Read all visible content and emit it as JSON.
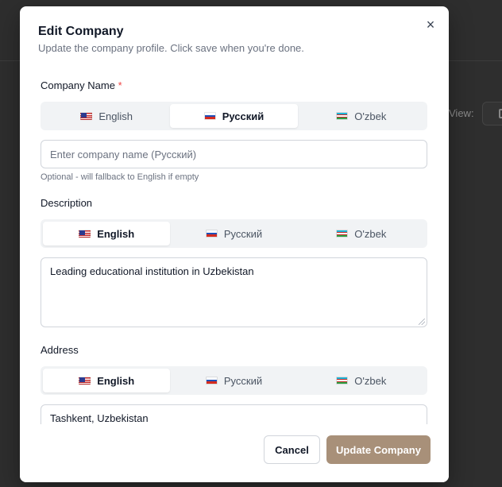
{
  "background": {
    "view_label": "View:"
  },
  "modal": {
    "title": "Edit Company",
    "description": "Update the company profile. Click save when you're done.",
    "close_symbol": "×"
  },
  "languages": {
    "en": "English",
    "ru": "Русский",
    "uz": "O'zbek"
  },
  "company_name": {
    "label": "Company Name",
    "required_mark": "*",
    "active_tab": "ru",
    "placeholder": "Enter company name (Русский)",
    "value": "",
    "hint": "Optional - will fallback to English if empty"
  },
  "description": {
    "label": "Description",
    "active_tab": "en",
    "value": "Leading educational institution in Uzbekistan"
  },
  "address": {
    "label": "Address",
    "active_tab": "en",
    "value": "Tashkent, Uzbekistan"
  },
  "footer": {
    "cancel_label": "Cancel",
    "submit_label": "Update Company"
  },
  "colors": {
    "primary_button": "#a89079",
    "required": "#ef4444"
  }
}
